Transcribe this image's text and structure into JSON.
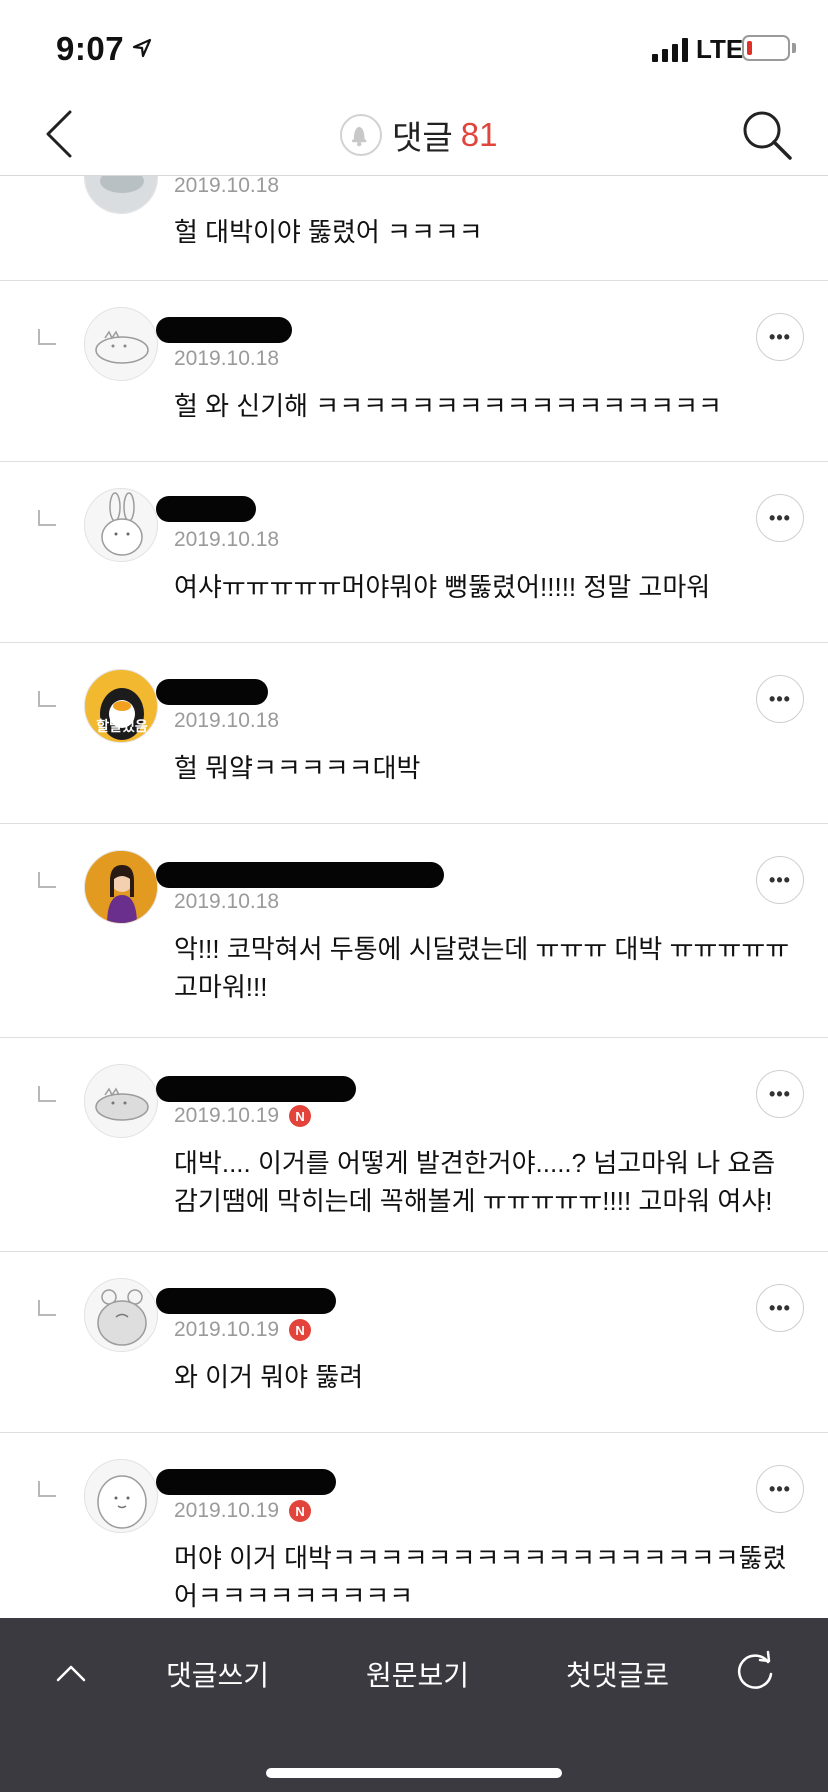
{
  "status_bar": {
    "time": "9:07",
    "network": "LTE"
  },
  "header": {
    "title": "댓글",
    "count": "81"
  },
  "comments": [
    {
      "date": "2019.10.18",
      "text": "헐 대박이야 뚫렸어 ㅋㅋㅋㅋ",
      "new": false
    },
    {
      "date": "2019.10.18",
      "text": "헐 와 신기해 ㅋㅋㅋㅋㅋㅋㅋㅋㅋㅋㅋㅋㅋㅋㅋㅋㅋ",
      "new": false
    },
    {
      "date": "2019.10.18",
      "text": "여샤ㅠㅠㅠㅠㅠ머야뭐야 뻥뚫렸어!!!!! 정말 고마워",
      "new": false
    },
    {
      "date": "2019.10.18",
      "text": "헐 뭐얔ㅋㅋㅋㅋㅋ대박",
      "new": false,
      "avatar_caption": "할말있음"
    },
    {
      "date": "2019.10.18",
      "text": "악!!! 코막혀서 두통에 시달렸는데 ㅠㅠㅠ 대박 ㅠㅠㅠㅠㅠ고마워!!!",
      "new": false
    },
    {
      "date": "2019.10.19",
      "text": "대박.... 이거를 어떻게 발견한거야.....? 넘고마워 나 요즘 감기땜에 막히는데 꼭해볼게 ㅠㅠㅠㅠㅠ!!!! 고마워 여샤!",
      "new": true
    },
    {
      "date": "2019.10.19",
      "text": "와 이거 뭐야 뚫려",
      "new": true
    },
    {
      "date": "2019.10.19",
      "text": "머야 이거 대박ㅋㅋㅋㅋㅋㅋㅋㅋㅋㅋㅋㅋㅋㅋㅋㅋㅋ뚫렸어ㅋㅋㅋㅋㅋㅋㅋㅋㅋ",
      "new": true
    }
  ],
  "new_badge": "N",
  "more_label": "•••",
  "bottom_bar": {
    "write": "댓글쓰기",
    "original": "원문보기",
    "first": "첫댓글로"
  }
}
